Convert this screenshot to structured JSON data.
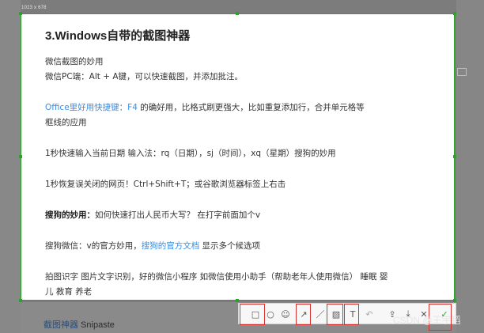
{
  "capture": {
    "size_label": "1023 x 678"
  },
  "article": {
    "title": "3.Windows自带的截图神器",
    "lines": {
      "wechat_title": "微信截图的妙用",
      "wechat_pc": "微信PC端：Alt + A键，可以快速截图，并添加批注。",
      "office_link": "Office里好用快捷键：F4",
      "office_text": " 的确好用，比格式刷更强大，比如重复添加行，合并单元格等",
      "office_text2": "框线的应用",
      "date_input": "1秒快速输入当前日期 输入法：rq（日期），sj（时间），xq（星期）搜狗的妙用",
      "restore_tab": "1秒恢复误关闭的网页！Ctrl+Shift+T；或谷歌浏览器标签上右击",
      "sogou_bold": "搜狗的妙用：",
      "sogou_text": "如何快速打出人民币大写？ 在打字前面加个v",
      "sogou_wechat_pre": "搜狗微信：v的官方妙用，",
      "sogou_wechat_link": "搜狗的官方文档",
      "sogou_wechat_post": " 显示多个候选项",
      "ocr_line1": "拍图识字 图片文字识别，好的微信小程序 如微信使用小助手（帮助老年人使用微信） 睡眠 婴",
      "ocr_line2": "儿 教育 养老"
    }
  },
  "background": {
    "link_text": "截图神器",
    "link_suffix": " Snipaste"
  },
  "toolbar": {
    "tools": [
      {
        "name": "rectangle-tool",
        "icon": "□"
      },
      {
        "name": "ellipse-tool",
        "icon": "○"
      },
      {
        "name": "marker-tool",
        "icon": "☺"
      },
      {
        "name": "arrow-tool",
        "icon": "↗"
      },
      {
        "name": "pencil-tool",
        "icon": "／"
      },
      {
        "name": "mosaic-tool",
        "icon": "▧"
      },
      {
        "name": "text-tool",
        "icon": "T"
      },
      {
        "name": "undo-tool",
        "icon": "↶"
      },
      {
        "name": "pin-tool",
        "icon": "⇪"
      },
      {
        "name": "save-tool",
        "icon": "⤓"
      },
      {
        "name": "cancel-tool",
        "icon": "✕"
      },
      {
        "name": "confirm-tool",
        "icon": "✓"
      }
    ]
  },
  "watermark": {
    "text": "CSDN @王宇韬"
  },
  "colors": {
    "selection": "#29a329",
    "highlight": "#d83131",
    "link": "#3d8ee0"
  }
}
